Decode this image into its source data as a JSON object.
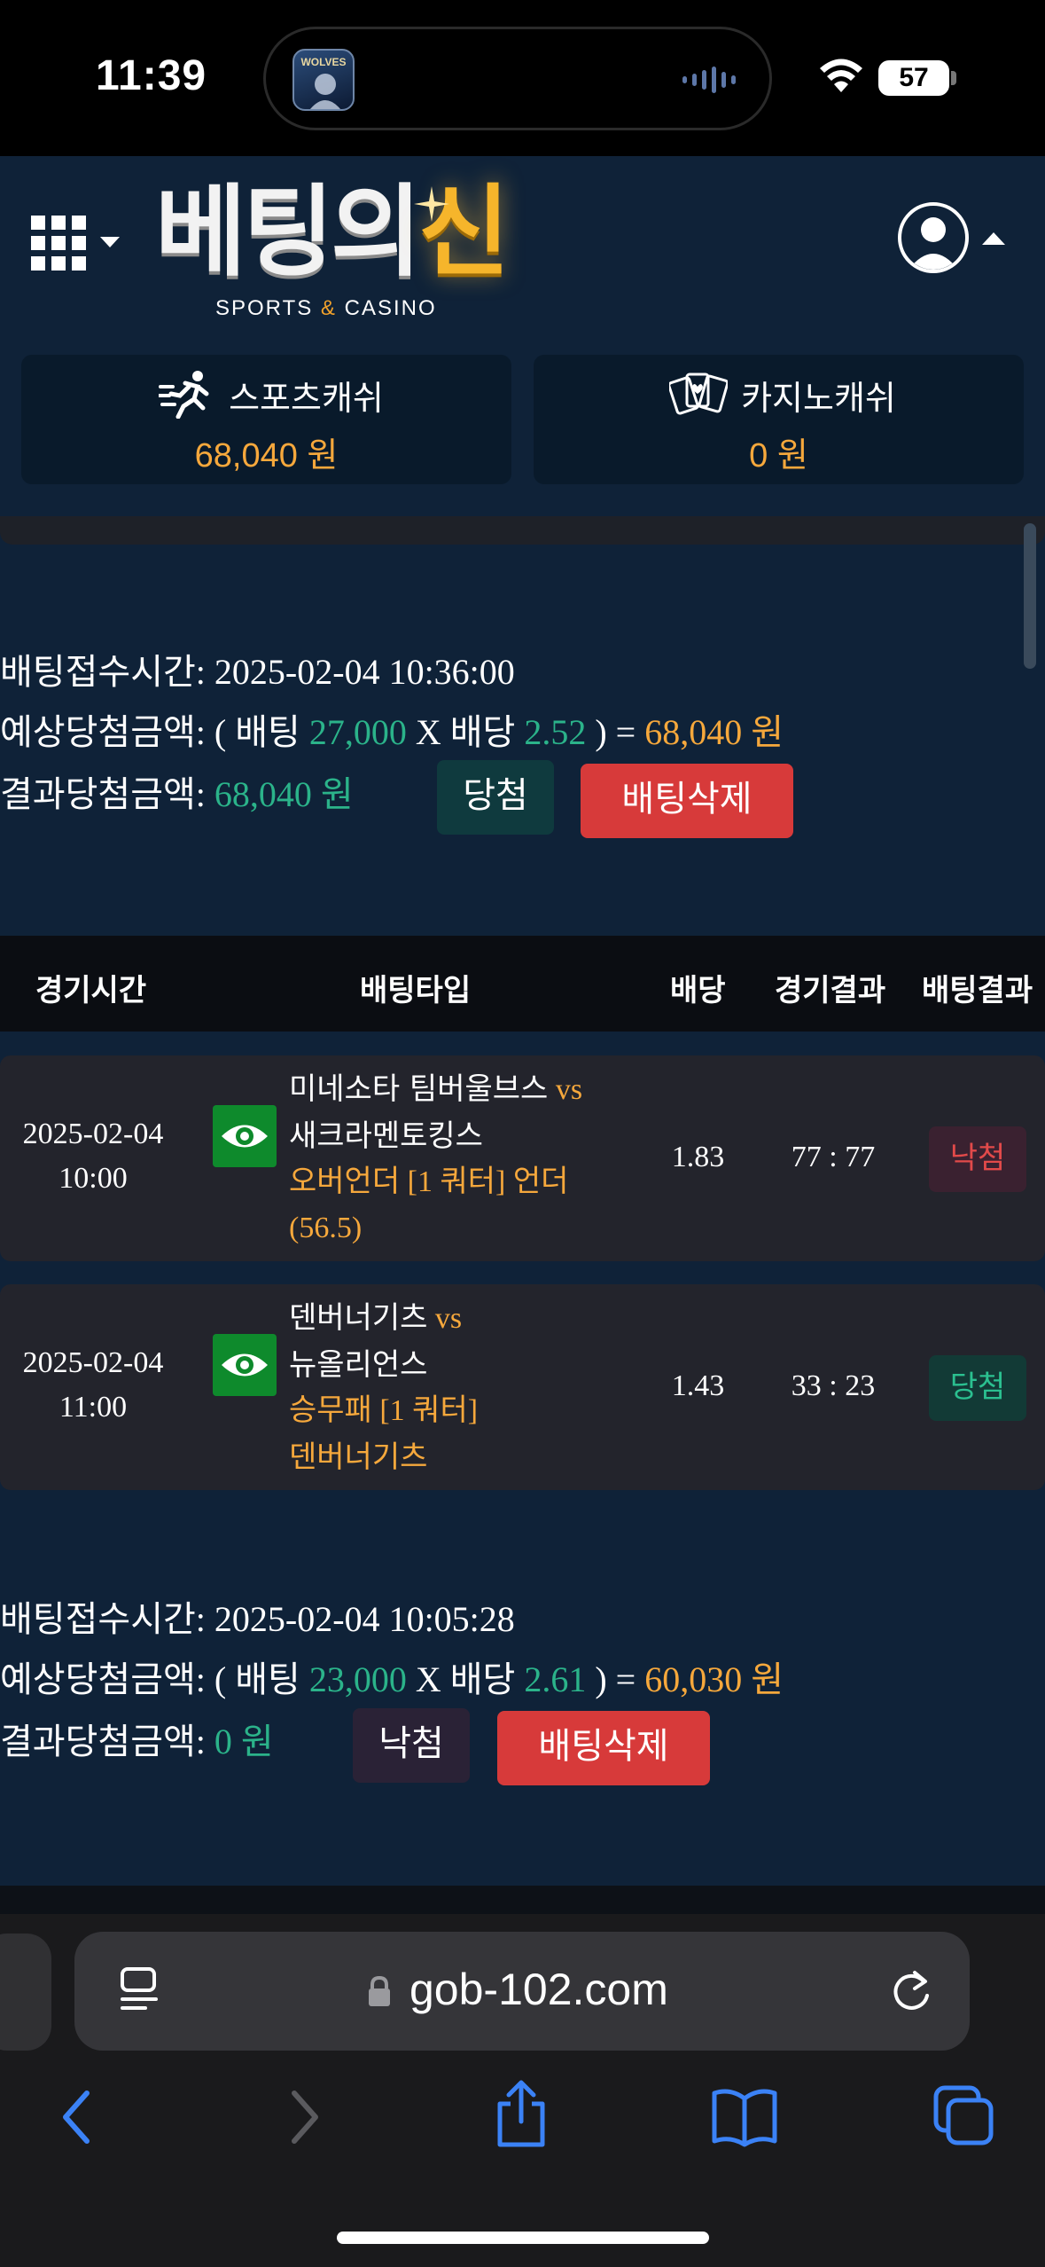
{
  "status_bar": {
    "time": "11:39",
    "battery": "57",
    "island_art_text": "WOLVES"
  },
  "header": {
    "logo_main": "베팅의",
    "logo_main_accent": "신",
    "logo_sub_left": "SPORTS",
    "logo_sub_amp": "&",
    "logo_sub_right": "CASINO"
  },
  "wallets": [
    {
      "label": "스포츠캐쉬",
      "value": "68,040 원",
      "icon": "runner-icon"
    },
    {
      "label": "카지노캐쉬",
      "value": "0 원",
      "icon": "cards-icon"
    }
  ],
  "bet1": {
    "time_label": "배팅접수시간:",
    "time_value": "2025-02-04 10:36:00",
    "expected_label": "예상당첨금액:",
    "open_paren": "( 배팅",
    "stake": "27,000",
    "x_text": "X 배당",
    "odds": "2.52",
    "close_eq": ") =",
    "expected_amount": "68,040 원",
    "result_label": "결과당첨금액:",
    "result_amount": "68,040 원",
    "status": "당첨",
    "delete_label": "배팅삭제"
  },
  "table": {
    "headers": [
      "경기시간",
      "배팅타입",
      "배당",
      "경기결과",
      "배팅결과"
    ],
    "rows": [
      {
        "date": "2025-02-04",
        "time": "10:00",
        "home": "미네소타 팀버울브스",
        "vs": "vs",
        "away": "새크라멘토킹스",
        "bet_line1": "오버언더 [1 쿼터] 언더",
        "bet_line2": "(56.5)",
        "odds": "1.83",
        "score": "77 : 77",
        "result": "낙첨"
      },
      {
        "date": "2025-02-04",
        "time": "11:00",
        "home": "덴버너기츠",
        "vs": "vs",
        "away": "뉴올리언스",
        "bet_line1": "승무패 [1 쿼터]",
        "bet_line2": "덴버너기츠",
        "odds": "1.43",
        "score": "33 : 23",
        "result": "당첨"
      }
    ]
  },
  "bet2": {
    "time_label": "배팅접수시간:",
    "time_value": "2025-02-04 10:05:28",
    "expected_label": "예상당첨금액:",
    "open_paren": "( 배팅",
    "stake": "23,000",
    "x_text": "X 배당",
    "odds": "2.61",
    "close_eq": ") =",
    "expected_amount": "60,030 원",
    "result_label": "결과당첨금액:",
    "result_amount": "0 원",
    "status": "낙첨",
    "delete_label": "배팅삭제"
  },
  "browser": {
    "url": "gob-102.com"
  },
  "colors": {
    "accent_green": "#2bb38a",
    "accent_orange": "#f6a83c",
    "danger_red": "#d73a3a",
    "page_bg": "#0f2238"
  }
}
